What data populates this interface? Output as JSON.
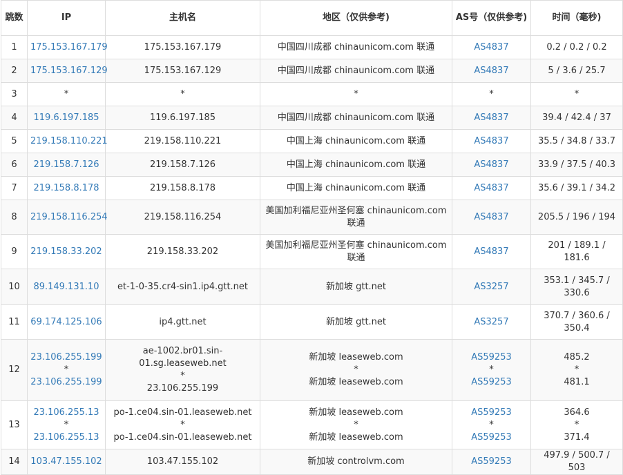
{
  "headers": {
    "hop": "跳数",
    "ip": "IP",
    "host": "主机名",
    "region": "地区（仅供参考)",
    "as": "AS号（仅供参考)",
    "time": "时间（毫秒)"
  },
  "rows": [
    {
      "hop": "1",
      "ip": [
        "175.153.167.179"
      ],
      "host": [
        "175.153.167.179"
      ],
      "region": [
        "中国四川成都 chinaunicom.com 联通"
      ],
      "as": [
        "AS4837"
      ],
      "time": [
        "0.2 / 0.2 / 0.2"
      ]
    },
    {
      "hop": "2",
      "ip": [
        "175.153.167.129"
      ],
      "host": [
        "175.153.167.129"
      ],
      "region": [
        "中国四川成都 chinaunicom.com 联通"
      ],
      "as": [
        "AS4837"
      ],
      "time": [
        "5 / 3.6 / 25.7"
      ]
    },
    {
      "hop": "3",
      "ip": [
        "*"
      ],
      "host": [
        "*"
      ],
      "region": [
        "*"
      ],
      "as": [
        "*"
      ],
      "time": [
        "*"
      ]
    },
    {
      "hop": "4",
      "ip": [
        "119.6.197.185"
      ],
      "host": [
        "119.6.197.185"
      ],
      "region": [
        "中国四川成都 chinaunicom.com 联通"
      ],
      "as": [
        "AS4837"
      ],
      "time": [
        "39.4 / 42.4 / 37"
      ]
    },
    {
      "hop": "5",
      "ip": [
        "219.158.110.221"
      ],
      "host": [
        "219.158.110.221"
      ],
      "region": [
        "中国上海 chinaunicom.com 联通"
      ],
      "as": [
        "AS4837"
      ],
      "time": [
        "35.5 / 34.8 / 33.7"
      ]
    },
    {
      "hop": "6",
      "ip": [
        "219.158.7.126"
      ],
      "host": [
        "219.158.7.126"
      ],
      "region": [
        "中国上海 chinaunicom.com 联通"
      ],
      "as": [
        "AS4837"
      ],
      "time": [
        "33.9 / 37.5 / 40.3"
      ]
    },
    {
      "hop": "7",
      "ip": [
        "219.158.8.178"
      ],
      "host": [
        "219.158.8.178"
      ],
      "region": [
        "中国上海 chinaunicom.com 联通"
      ],
      "as": [
        "AS4837"
      ],
      "time": [
        "35.6 / 39.1 / 34.2"
      ]
    },
    {
      "hop": "8",
      "ip": [
        "219.158.116.254"
      ],
      "host": [
        "219.158.116.254"
      ],
      "region": [
        "美国加利福尼亚州圣何塞 chinaunicom.com 联通"
      ],
      "as": [
        "AS4837"
      ],
      "time": [
        "205.5 / 196 / 194"
      ]
    },
    {
      "hop": "9",
      "ip": [
        "219.158.33.202"
      ],
      "host": [
        "219.158.33.202"
      ],
      "region": [
        "美国加利福尼亚州圣何塞 chinaunicom.com 联通"
      ],
      "as": [
        "AS4837"
      ],
      "time": [
        "201 / 189.1 / 181.6"
      ]
    },
    {
      "hop": "10",
      "ip": [
        "89.149.131.10"
      ],
      "host": [
        "et-1-0-35.cr4-sin1.ip4.gtt.net"
      ],
      "region": [
        "新加坡 gtt.net"
      ],
      "as": [
        "AS3257"
      ],
      "time": [
        "353.1 / 345.7 / 330.6"
      ]
    },
    {
      "hop": "11",
      "ip": [
        "69.174.125.106"
      ],
      "host": [
        "ip4.gtt.net"
      ],
      "region": [
        "新加坡 gtt.net"
      ],
      "as": [
        "AS3257"
      ],
      "time": [
        "370.7 / 360.6 / 350.4"
      ]
    },
    {
      "hop": "12",
      "ip": [
        "23.106.255.199",
        "*",
        "23.106.255.199"
      ],
      "host": [
        "ae-1002.br01.sin-01.sg.leaseweb.net",
        "*",
        "23.106.255.199"
      ],
      "region": [
        "新加坡 leaseweb.com",
        "*",
        "新加坡 leaseweb.com"
      ],
      "as": [
        "AS59253",
        "*",
        "AS59253"
      ],
      "time": [
        "485.2",
        "*",
        "481.1"
      ]
    },
    {
      "hop": "13",
      "ip": [
        "23.106.255.13",
        "*",
        "23.106.255.13"
      ],
      "host": [
        "po-1.ce04.sin-01.leaseweb.net",
        "*",
        "po-1.ce04.sin-01.leaseweb.net"
      ],
      "region": [
        "新加坡 leaseweb.com",
        "*",
        "新加坡 leaseweb.com"
      ],
      "as": [
        "AS59253",
        "*",
        "AS59253"
      ],
      "time": [
        "364.6",
        "*",
        "371.4"
      ]
    },
    {
      "hop": "14",
      "ip": [
        "103.47.155.102"
      ],
      "host": [
        "103.47.155.102"
      ],
      "region": [
        "新加坡 controlvm.com"
      ],
      "as": [
        "AS59253"
      ],
      "time": [
        "497.9 / 500.7 / 503"
      ]
    }
  ]
}
